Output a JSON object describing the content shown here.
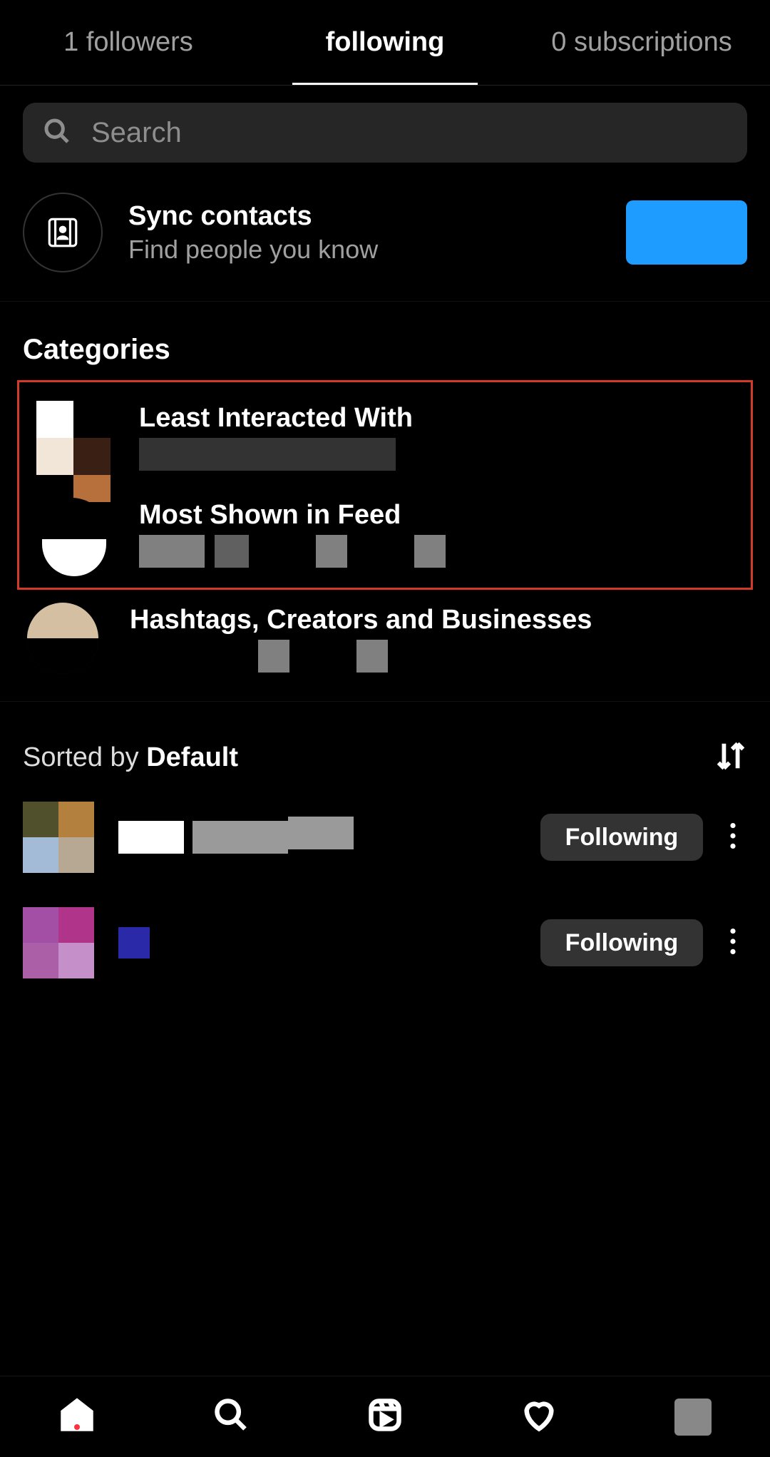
{
  "tabs": {
    "followers": "1 followers",
    "following": "following",
    "subscriptions": "0 subscriptions"
  },
  "search": {
    "placeholder": "Search"
  },
  "sync": {
    "title": "Sync contacts",
    "subtitle": "Find people you know"
  },
  "categories_header": "Categories",
  "categories": {
    "least": {
      "title": "Least Interacted With"
    },
    "most": {
      "title": "Most Shown in Feed"
    },
    "hash": {
      "title": "Hashtags, Creators and Businesses"
    }
  },
  "sort": {
    "prefix": "Sorted by ",
    "value": "Default"
  },
  "follow_button_label": "Following"
}
